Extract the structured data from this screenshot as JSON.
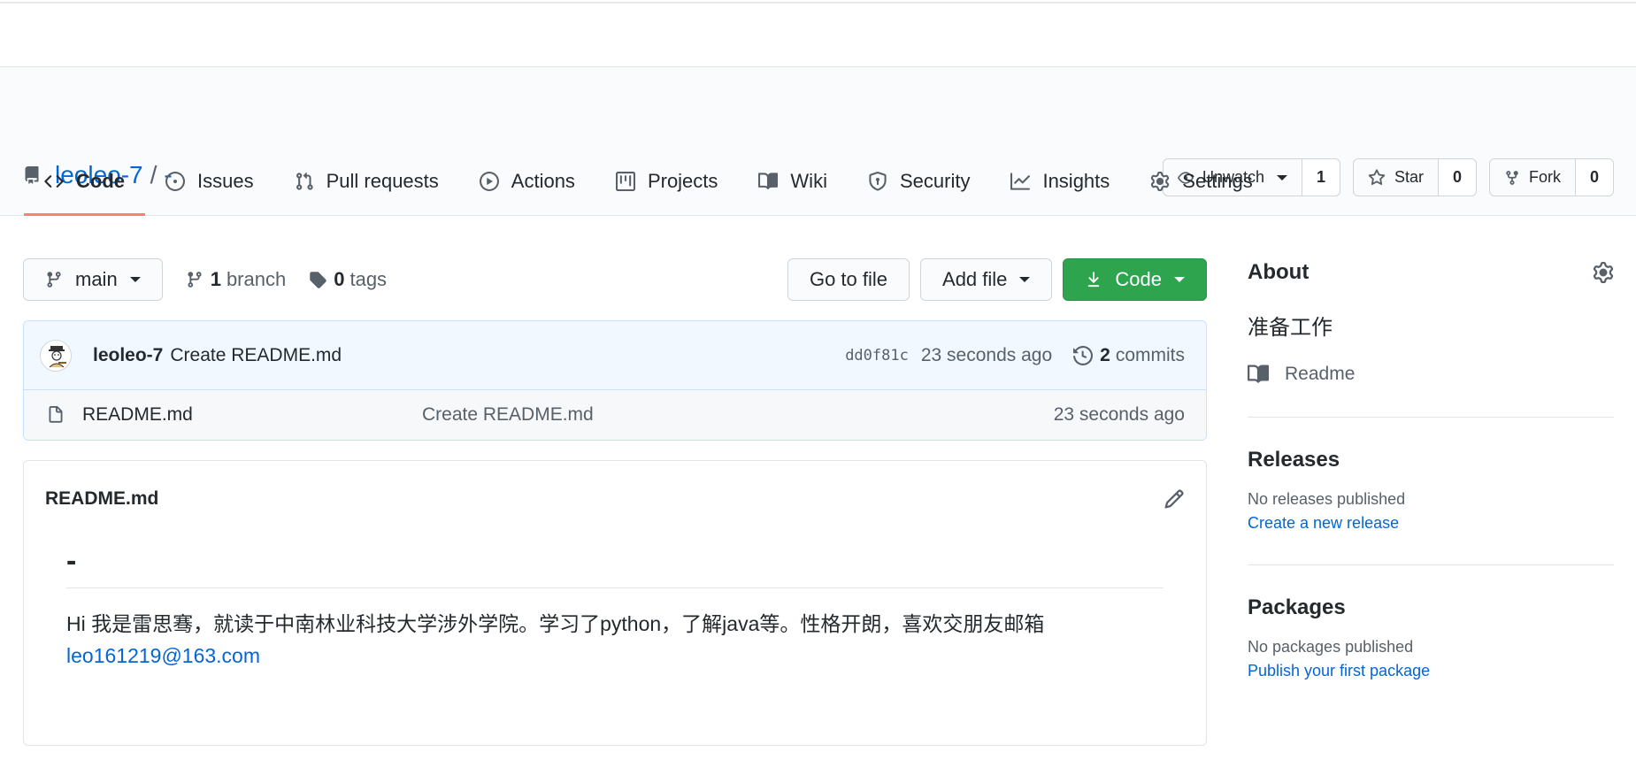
{
  "repo": {
    "owner": "leoleo-7",
    "separator": "/",
    "name": "-"
  },
  "actions": {
    "watch": {
      "label": "Unwatch",
      "count": "1"
    },
    "star": {
      "label": "Star",
      "count": "0"
    },
    "fork": {
      "label": "Fork",
      "count": "0"
    }
  },
  "tabs": [
    {
      "label": "Code",
      "icon": "code-icon"
    },
    {
      "label": "Issues",
      "icon": "issue-icon"
    },
    {
      "label": "Pull requests",
      "icon": "pull-request-icon"
    },
    {
      "label": "Actions",
      "icon": "play-icon"
    },
    {
      "label": "Projects",
      "icon": "project-icon"
    },
    {
      "label": "Wiki",
      "icon": "book-icon"
    },
    {
      "label": "Security",
      "icon": "shield-icon"
    },
    {
      "label": "Insights",
      "icon": "graph-icon"
    },
    {
      "label": "Settings",
      "icon": "gear-icon"
    }
  ],
  "filebar": {
    "branch": "main",
    "branches_count": "1",
    "branches_label": "branch",
    "tags_count": "0",
    "tags_label": "tags",
    "go_to_file": "Go to file",
    "add_file": "Add file",
    "code": "Code"
  },
  "commit": {
    "author": "leoleo-7",
    "message": "Create README.md",
    "sha": "dd0f81c",
    "time": "23 seconds ago",
    "commits_count": "2",
    "commits_label": "commits"
  },
  "files": [
    {
      "name": "README.md",
      "message": "Create README.md",
      "time": "23 seconds ago"
    }
  ],
  "readme": {
    "filename": "README.md",
    "heading": "-",
    "text": "Hi 我是雷思骞，就读于中南林业科技大学涉外学院。学习了python，了解java等。性格开朗，喜欢交朋友邮箱",
    "email": "leo161219@163.com"
  },
  "sidebar": {
    "about_title": "About",
    "description": "准备工作",
    "readme_label": "Readme",
    "releases_title": "Releases",
    "releases_none": "No releases published",
    "releases_link": "Create a new release",
    "packages_title": "Packages",
    "packages_none": "No packages published",
    "packages_link": "Publish your first package"
  },
  "colors": {
    "link": "#0366d6",
    "primary": "#2ea44f",
    "tab_active_border": "#f9826c",
    "commit_bg": "#f1f8ff"
  }
}
